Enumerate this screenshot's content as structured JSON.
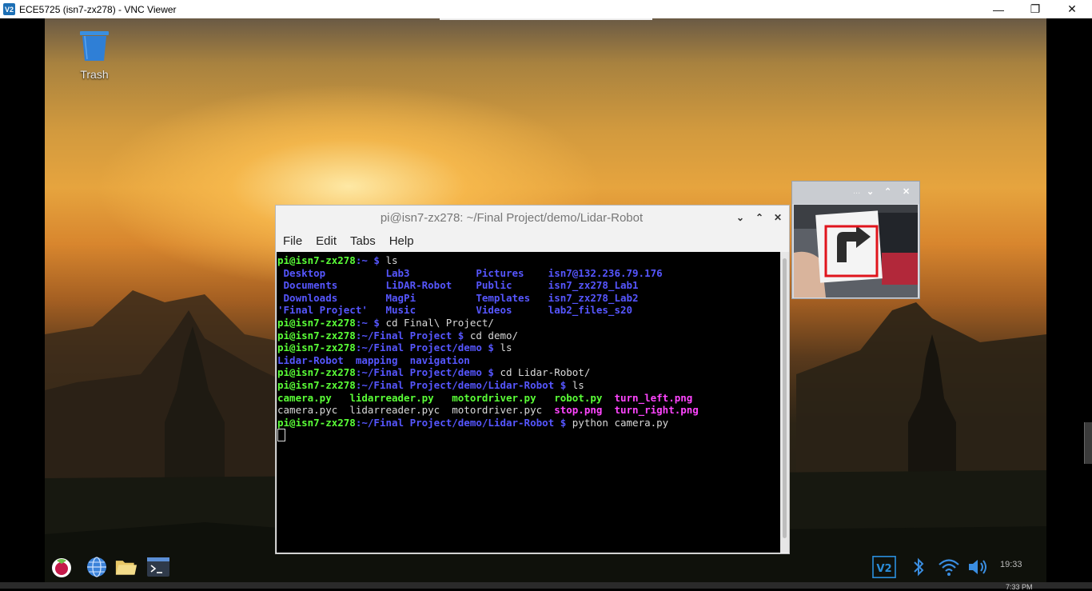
{
  "vnc_window": {
    "title": "ECE5725 (isn7-zx278) - VNC Viewer",
    "logo": "V2",
    "controls": {
      "minimize": "—",
      "restore": "❐",
      "close": "✕"
    }
  },
  "desktop": {
    "trash_label": "Trash"
  },
  "terminal": {
    "title": "pi@isn7-zx278: ~/Final Project/demo/Lidar-Robot",
    "controls": {
      "minimize": "⌄",
      "maximize": "⌃",
      "close": "✕"
    },
    "menu": [
      "File",
      "Edit",
      "Tabs",
      "Help"
    ],
    "lines": [
      [
        {
          "t": "pi@isn7-zx278:~ $ ",
          "c": "prompt"
        },
        {
          "t": "ls",
          "c": "w"
        }
      ],
      [
        {
          "t": " Desktop          ",
          "c": "b"
        },
        {
          "t": "Lab3           ",
          "c": "b"
        },
        {
          "t": "Pictures    ",
          "c": "b"
        },
        {
          "t": "isn7@132.236.79.176",
          "c": "b"
        }
      ],
      [
        {
          "t": " Documents        ",
          "c": "b"
        },
        {
          "t": "LiDAR-Robot    ",
          "c": "b"
        },
        {
          "t": "Public      ",
          "c": "b"
        },
        {
          "t": "isn7_zx278_Lab1",
          "c": "b"
        }
      ],
      [
        {
          "t": " Downloads        ",
          "c": "b"
        },
        {
          "t": "MagPi          ",
          "c": "b"
        },
        {
          "t": "Templates   ",
          "c": "b"
        },
        {
          "t": "isn7_zx278_Lab2",
          "c": "b"
        }
      ],
      [
        {
          "t": "'Final Project'   ",
          "c": "b"
        },
        {
          "t": "Music          ",
          "c": "b"
        },
        {
          "t": "Videos      ",
          "c": "b"
        },
        {
          "t": "lab2_files_s20",
          "c": "b"
        }
      ],
      [
        {
          "t": "pi@isn7-zx278:~ $ ",
          "c": "prompt"
        },
        {
          "t": "cd Final\\ Project/",
          "c": "w"
        }
      ],
      [
        {
          "t": "pi@isn7-zx278:~/Final Project $ ",
          "c": "prompt"
        },
        {
          "t": "cd demo/",
          "c": "w"
        }
      ],
      [
        {
          "t": "pi@isn7-zx278:~/Final Project/demo $ ",
          "c": "prompt"
        },
        {
          "t": "ls",
          "c": "w"
        }
      ],
      [
        {
          "t": "Lidar-Robot  ",
          "c": "b"
        },
        {
          "t": "mapping  ",
          "c": "b"
        },
        {
          "t": "navigation",
          "c": "b"
        }
      ],
      [
        {
          "t": "pi@isn7-zx278:~/Final Project/demo $ ",
          "c": "prompt"
        },
        {
          "t": "cd Lidar-Robot/",
          "c": "w"
        }
      ],
      [
        {
          "t": "pi@isn7-zx278:~/Final Project/demo/Lidar-Robot $ ",
          "c": "prompt"
        },
        {
          "t": "ls",
          "c": "w"
        }
      ],
      [
        {
          "t": "camera.py",
          "c": "g"
        },
        {
          "t": "   ",
          "c": "w"
        },
        {
          "t": "lidarreader.py",
          "c": "g"
        },
        {
          "t": "   ",
          "c": "w"
        },
        {
          "t": "motordriver.py",
          "c": "g"
        },
        {
          "t": "   ",
          "c": "w"
        },
        {
          "t": "robot.py",
          "c": "g"
        },
        {
          "t": "  ",
          "c": "w"
        },
        {
          "t": "turn_left.png",
          "c": "m"
        }
      ],
      [
        {
          "t": "camera.pyc  lidarreader.pyc  motordriver.pyc  ",
          "c": "w"
        },
        {
          "t": "stop.png",
          "c": "m"
        },
        {
          "t": "  ",
          "c": "w"
        },
        {
          "t": "turn_right.png",
          "c": "m"
        }
      ],
      [
        {
          "t": "pi@isn7-zx278:~/Final Project/demo/Lidar-Robot $ ",
          "c": "prompt"
        },
        {
          "t": "python camera.py",
          "c": "w"
        }
      ]
    ]
  },
  "camera_window": {
    "controls": [
      "...",
      "⌄",
      "⌃",
      "✕"
    ]
  },
  "taskbar": {
    "left_icons": [
      "raspberry-menu-icon",
      "web-browser-icon",
      "file-manager-icon",
      "terminal-icon"
    ],
    "tray_icons": [
      "vnc-server-icon",
      "bluetooth-icon",
      "wifi-icon",
      "volume-icon"
    ],
    "clock": "19:33"
  },
  "host_taskbar": {
    "clock": "7:33 PM"
  },
  "colors": {
    "prompt_user": "#5aff37",
    "prompt_path": "#5656ff",
    "directory": "#5656ff",
    "executable": "#5aff37",
    "image_file": "#ff45ff"
  }
}
